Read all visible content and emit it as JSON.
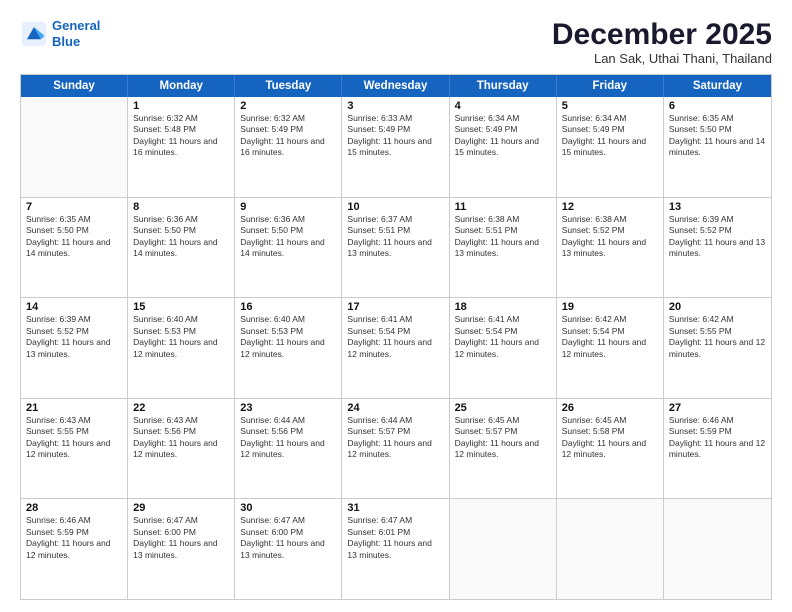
{
  "header": {
    "logo_line1": "General",
    "logo_line2": "Blue",
    "month": "December 2025",
    "location": "Lan Sak, Uthai Thani, Thailand"
  },
  "days_of_week": [
    "Sunday",
    "Monday",
    "Tuesday",
    "Wednesday",
    "Thursday",
    "Friday",
    "Saturday"
  ],
  "weeks": [
    [
      {
        "day": "",
        "empty": true
      },
      {
        "day": "1",
        "sunrise": "6:32 AM",
        "sunset": "5:48 PM",
        "daylight": "11 hours and 16 minutes."
      },
      {
        "day": "2",
        "sunrise": "6:32 AM",
        "sunset": "5:49 PM",
        "daylight": "11 hours and 16 minutes."
      },
      {
        "day": "3",
        "sunrise": "6:33 AM",
        "sunset": "5:49 PM",
        "daylight": "11 hours and 15 minutes."
      },
      {
        "day": "4",
        "sunrise": "6:34 AM",
        "sunset": "5:49 PM",
        "daylight": "11 hours and 15 minutes."
      },
      {
        "day": "5",
        "sunrise": "6:34 AM",
        "sunset": "5:49 PM",
        "daylight": "11 hours and 15 minutes."
      },
      {
        "day": "6",
        "sunrise": "6:35 AM",
        "sunset": "5:50 PM",
        "daylight": "11 hours and 14 minutes."
      }
    ],
    [
      {
        "day": "7",
        "sunrise": "6:35 AM",
        "sunset": "5:50 PM",
        "daylight": "11 hours and 14 minutes."
      },
      {
        "day": "8",
        "sunrise": "6:36 AM",
        "sunset": "5:50 PM",
        "daylight": "11 hours and 14 minutes."
      },
      {
        "day": "9",
        "sunrise": "6:36 AM",
        "sunset": "5:50 PM",
        "daylight": "11 hours and 14 minutes."
      },
      {
        "day": "10",
        "sunrise": "6:37 AM",
        "sunset": "5:51 PM",
        "daylight": "11 hours and 13 minutes."
      },
      {
        "day": "11",
        "sunrise": "6:38 AM",
        "sunset": "5:51 PM",
        "daylight": "11 hours and 13 minutes."
      },
      {
        "day": "12",
        "sunrise": "6:38 AM",
        "sunset": "5:52 PM",
        "daylight": "11 hours and 13 minutes."
      },
      {
        "day": "13",
        "sunrise": "6:39 AM",
        "sunset": "5:52 PM",
        "daylight": "11 hours and 13 minutes."
      }
    ],
    [
      {
        "day": "14",
        "sunrise": "6:39 AM",
        "sunset": "5:52 PM",
        "daylight": "11 hours and 13 minutes."
      },
      {
        "day": "15",
        "sunrise": "6:40 AM",
        "sunset": "5:53 PM",
        "daylight": "11 hours and 12 minutes."
      },
      {
        "day": "16",
        "sunrise": "6:40 AM",
        "sunset": "5:53 PM",
        "daylight": "11 hours and 12 minutes."
      },
      {
        "day": "17",
        "sunrise": "6:41 AM",
        "sunset": "5:54 PM",
        "daylight": "11 hours and 12 minutes."
      },
      {
        "day": "18",
        "sunrise": "6:41 AM",
        "sunset": "5:54 PM",
        "daylight": "11 hours and 12 minutes."
      },
      {
        "day": "19",
        "sunrise": "6:42 AM",
        "sunset": "5:54 PM",
        "daylight": "11 hours and 12 minutes."
      },
      {
        "day": "20",
        "sunrise": "6:42 AM",
        "sunset": "5:55 PM",
        "daylight": "11 hours and 12 minutes."
      }
    ],
    [
      {
        "day": "21",
        "sunrise": "6:43 AM",
        "sunset": "5:55 PM",
        "daylight": "11 hours and 12 minutes."
      },
      {
        "day": "22",
        "sunrise": "6:43 AM",
        "sunset": "5:56 PM",
        "daylight": "11 hours and 12 minutes."
      },
      {
        "day": "23",
        "sunrise": "6:44 AM",
        "sunset": "5:56 PM",
        "daylight": "11 hours and 12 minutes."
      },
      {
        "day": "24",
        "sunrise": "6:44 AM",
        "sunset": "5:57 PM",
        "daylight": "11 hours and 12 minutes."
      },
      {
        "day": "25",
        "sunrise": "6:45 AM",
        "sunset": "5:57 PM",
        "daylight": "11 hours and 12 minutes."
      },
      {
        "day": "26",
        "sunrise": "6:45 AM",
        "sunset": "5:58 PM",
        "daylight": "11 hours and 12 minutes."
      },
      {
        "day": "27",
        "sunrise": "6:46 AM",
        "sunset": "5:59 PM",
        "daylight": "11 hours and 12 minutes."
      }
    ],
    [
      {
        "day": "28",
        "sunrise": "6:46 AM",
        "sunset": "5:59 PM",
        "daylight": "11 hours and 12 minutes."
      },
      {
        "day": "29",
        "sunrise": "6:47 AM",
        "sunset": "6:00 PM",
        "daylight": "11 hours and 13 minutes."
      },
      {
        "day": "30",
        "sunrise": "6:47 AM",
        "sunset": "6:00 PM",
        "daylight": "11 hours and 13 minutes."
      },
      {
        "day": "31",
        "sunrise": "6:47 AM",
        "sunset": "6:01 PM",
        "daylight": "11 hours and 13 minutes."
      },
      {
        "day": "",
        "empty": true
      },
      {
        "day": "",
        "empty": true
      },
      {
        "day": "",
        "empty": true
      }
    ]
  ]
}
